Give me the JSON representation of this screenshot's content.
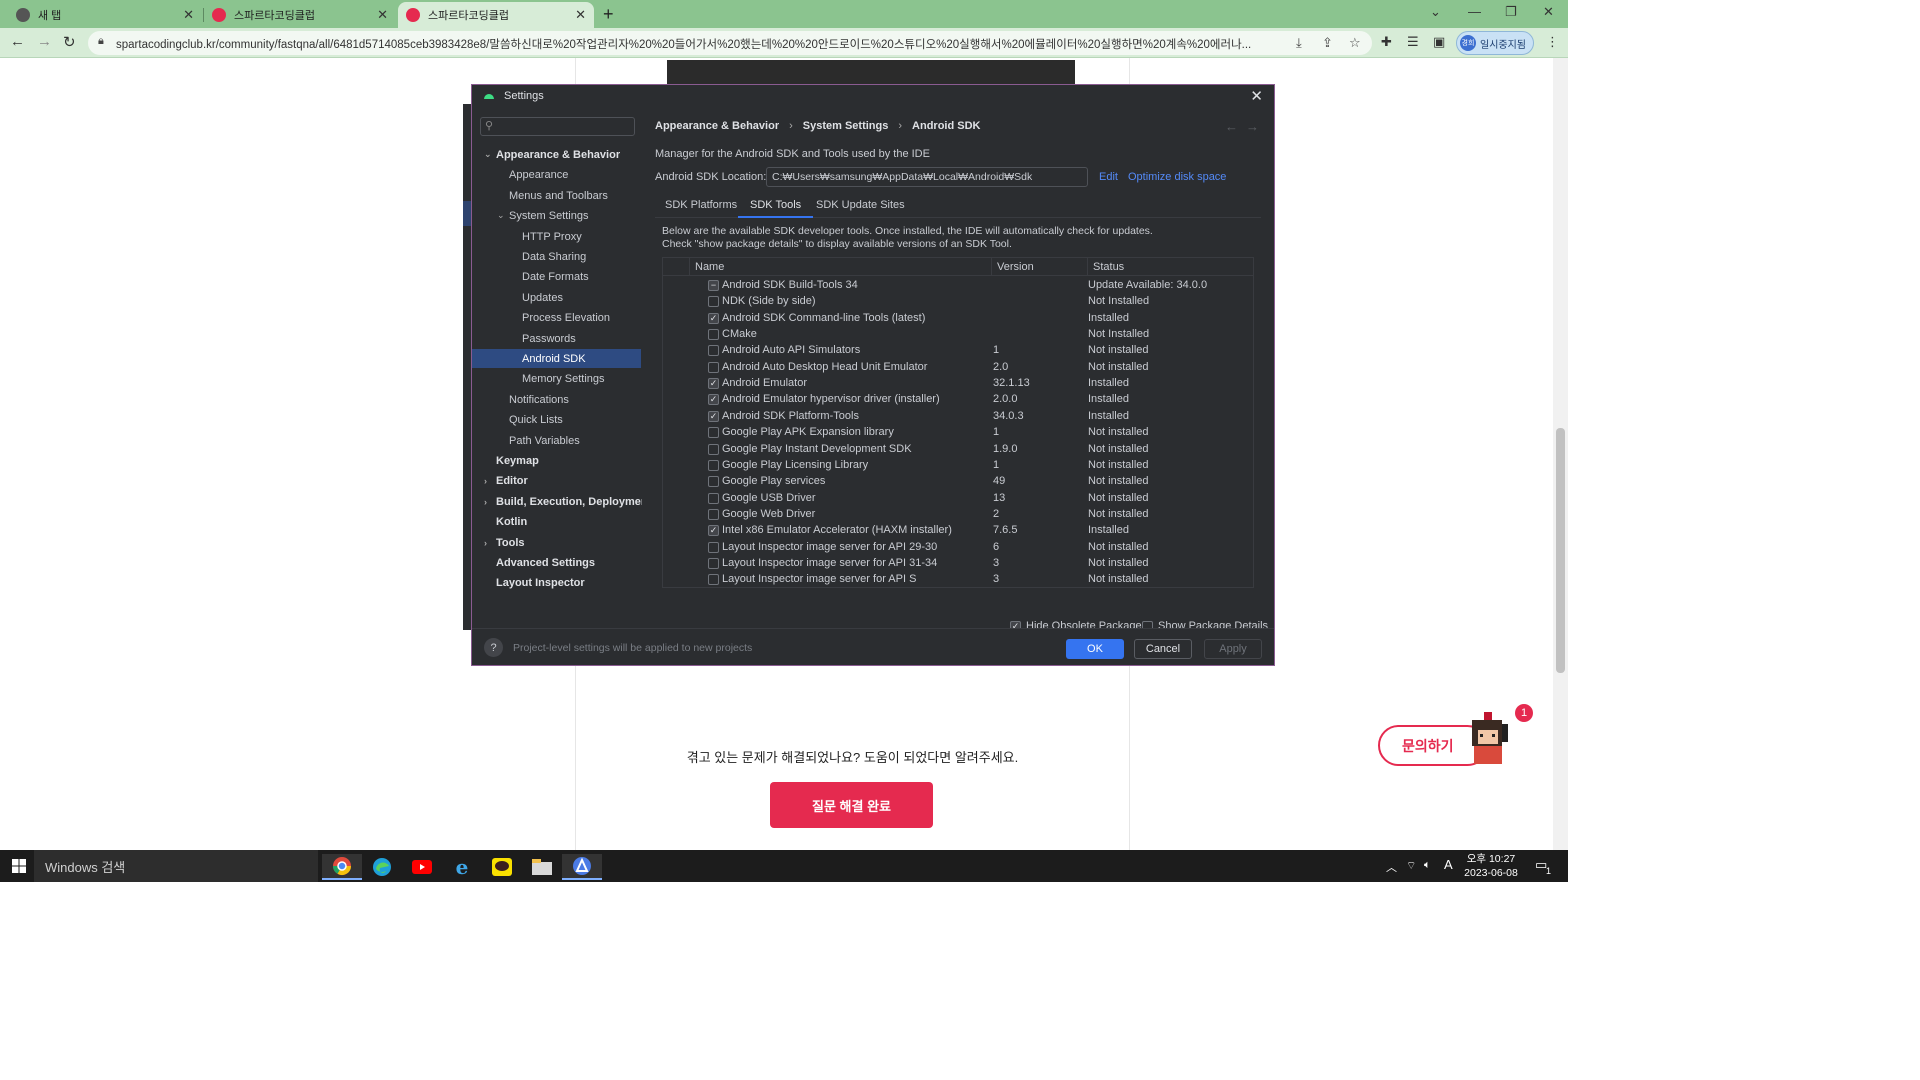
{
  "browser": {
    "tabs": [
      {
        "title": "새 탭",
        "active": false
      },
      {
        "title": "스파르타코딩클럽",
        "active": false
      },
      {
        "title": "스파르타코딩클럽",
        "active": true
      }
    ],
    "url": "spartacodingclub.kr/community/fastqna/all/6481d5714085ceb3983428e8/말씀하신대로%20작업관리자%20%20들어가서%20했는데%20%20안드로이드%20스튜디오%20실행해서%20에뮬레이터%20실행하면%20계속%20에러나...",
    "profile_label": "일시중지됨",
    "profile_avatar": "경희"
  },
  "page": {
    "question_text": "겪고 있는 문제가 해결되었나요? 도움이 되었다면 알려주세요.",
    "resolve_button": "질문 해결 완료",
    "inquiry_button": "문의하기",
    "notification_count": "1"
  },
  "dialog": {
    "title": "Settings",
    "sidebar": [
      {
        "label": "Appearance & Behavior",
        "level": 0,
        "expanded": true,
        "bold": true
      },
      {
        "label": "Appearance",
        "level": 1
      },
      {
        "label": "Menus and Toolbars",
        "level": 1
      },
      {
        "label": "System Settings",
        "level": 1,
        "expanded": true
      },
      {
        "label": "HTTP Proxy",
        "level": 2
      },
      {
        "label": "Data Sharing",
        "level": 2
      },
      {
        "label": "Date Formats",
        "level": 2
      },
      {
        "label": "Updates",
        "level": 2
      },
      {
        "label": "Process Elevation",
        "level": 2
      },
      {
        "label": "Passwords",
        "level": 2
      },
      {
        "label": "Android SDK",
        "level": 2,
        "selected": true
      },
      {
        "label": "Memory Settings",
        "level": 2
      },
      {
        "label": "Notifications",
        "level": 1
      },
      {
        "label": "Quick Lists",
        "level": 1
      },
      {
        "label": "Path Variables",
        "level": 1
      },
      {
        "label": "Keymap",
        "level": 0,
        "bold": true
      },
      {
        "label": "Editor",
        "level": 0,
        "collapsed": true,
        "bold": true
      },
      {
        "label": "Build, Execution, Deployment",
        "level": 0,
        "collapsed": true,
        "bold": true
      },
      {
        "label": "Kotlin",
        "level": 0,
        "bold": true
      },
      {
        "label": "Tools",
        "level": 0,
        "collapsed": true,
        "bold": true
      },
      {
        "label": "Advanced Settings",
        "level": 0,
        "bold": true
      },
      {
        "label": "Layout Inspector",
        "level": 0,
        "bold": true
      }
    ],
    "breadcrumb": [
      "Appearance & Behavior",
      "System Settings",
      "Android SDK"
    ],
    "manager_desc": "Manager for the Android SDK and Tools used by the IDE",
    "location_label": "Android SDK Location:",
    "location_value": "C:₩Users₩samsung₩AppData₩Local₩Android₩Sdk",
    "edit_link": "Edit",
    "optimize_link": "Optimize disk space",
    "tabs": [
      "SDK Platforms",
      "SDK Tools",
      "SDK Update Sites"
    ],
    "active_tab": "SDK Tools",
    "tools_desc_line1": "Below are the available SDK developer tools. Once installed, the IDE will automatically check for updates.",
    "tools_desc_line2": "Check \"show package details\" to display available versions of an SDK Tool.",
    "columns": {
      "name": "Name",
      "version": "Version",
      "status": "Status"
    },
    "rows": [
      {
        "name": "Android SDK Build-Tools 34",
        "version": "",
        "status": "Update Available: 34.0.0",
        "check": "partial"
      },
      {
        "name": "NDK (Side by side)",
        "version": "",
        "status": "Not Installed",
        "check": "off"
      },
      {
        "name": "Android SDK Command-line Tools (latest)",
        "version": "",
        "status": "Installed",
        "check": "on"
      },
      {
        "name": "CMake",
        "version": "",
        "status": "Not Installed",
        "check": "off"
      },
      {
        "name": "Android Auto API Simulators",
        "version": "1",
        "status": "Not installed",
        "check": "off"
      },
      {
        "name": "Android Auto Desktop Head Unit Emulator",
        "version": "2.0",
        "status": "Not installed",
        "check": "off"
      },
      {
        "name": "Android Emulator",
        "version": "32.1.13",
        "status": "Installed",
        "check": "on"
      },
      {
        "name": "Android Emulator hypervisor driver (installer)",
        "version": "2.0.0",
        "status": "Installed",
        "check": "on"
      },
      {
        "name": "Android SDK Platform-Tools",
        "version": "34.0.3",
        "status": "Installed",
        "check": "on"
      },
      {
        "name": "Google Play APK Expansion library",
        "version": "1",
        "status": "Not installed",
        "check": "off"
      },
      {
        "name": "Google Play Instant Development SDK",
        "version": "1.9.0",
        "status": "Not installed",
        "check": "off"
      },
      {
        "name": "Google Play Licensing Library",
        "version": "1",
        "status": "Not installed",
        "check": "off"
      },
      {
        "name": "Google Play services",
        "version": "49",
        "status": "Not installed",
        "check": "off"
      },
      {
        "name": "Google USB Driver",
        "version": "13",
        "status": "Not installed",
        "check": "off"
      },
      {
        "name": "Google Web Driver",
        "version": "2",
        "status": "Not installed",
        "check": "off"
      },
      {
        "name": "Intel x86 Emulator Accelerator (HAXM installer)",
        "version": "7.6.5",
        "status": "Installed",
        "check": "on"
      },
      {
        "name": "Layout Inspector image server for API 29-30",
        "version": "6",
        "status": "Not installed",
        "check": "off"
      },
      {
        "name": "Layout Inspector image server for API 31-34",
        "version": "3",
        "status": "Not installed",
        "check": "off"
      },
      {
        "name": "Layout Inspector image server for API S",
        "version": "3",
        "status": "Not installed",
        "check": "off"
      }
    ],
    "hide_obsolete_label": "Hide Obsolete Packages",
    "hide_obsolete_checked": true,
    "show_details_label": "Show Package Details",
    "show_details_checked": false,
    "footer_note": "Project-level settings will be applied to new projects",
    "ok": "OK",
    "cancel": "Cancel",
    "apply": "Apply"
  },
  "taskbar": {
    "search_placeholder": "Windows 검색",
    "time": "오후 10:27",
    "date": "2023-06-08",
    "ime": "A",
    "notification_count": "1"
  }
}
